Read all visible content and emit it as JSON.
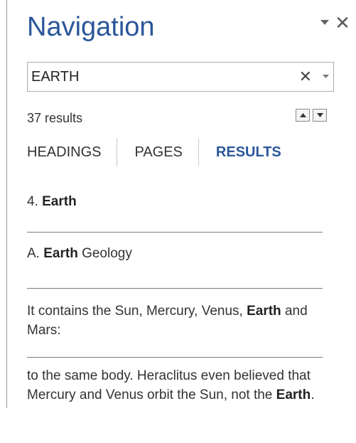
{
  "pane": {
    "title": "Navigation",
    "options_icon": "dropdown-triangle-icon",
    "close_glyph": "✕"
  },
  "search": {
    "value": "EARTH",
    "placeholder": "",
    "clear_glyph": "✕",
    "dropdown_glyph": "▼"
  },
  "results": {
    "count_text": "37 results",
    "prev_glyph": "▲",
    "next_glyph": "▼"
  },
  "tabs": [
    {
      "label": "HEADINGS",
      "active": false
    },
    {
      "label": "PAGES",
      "active": false
    },
    {
      "label": "RESULTS",
      "active": true
    }
  ],
  "items": [
    {
      "segments": [
        {
          "text": "4. ",
          "bold": false
        },
        {
          "text": "Earth",
          "bold": true
        }
      ]
    },
    {
      "segments": [
        {
          "text": "A. ",
          "bold": false
        },
        {
          "text": "Earth",
          "bold": true
        },
        {
          "text": " Geology",
          "bold": false
        }
      ]
    },
    {
      "segments": [
        {
          "text": "It contains the Sun, Mercury, Venus, ",
          "bold": false
        },
        {
          "text": "Earth",
          "bold": true
        },
        {
          "text": " and Mars:",
          "bold": false
        }
      ]
    },
    {
      "segments": [
        {
          "text": "to the same body. Heraclitus even believed that Mercury and Venus orbit the Sun, not the ",
          "bold": false
        },
        {
          "text": "Earth",
          "bold": true
        },
        {
          "text": ".",
          "bold": false
        }
      ]
    }
  ],
  "colors": {
    "accent": "#2b579a",
    "text": "#333333",
    "border": "#ababab"
  }
}
